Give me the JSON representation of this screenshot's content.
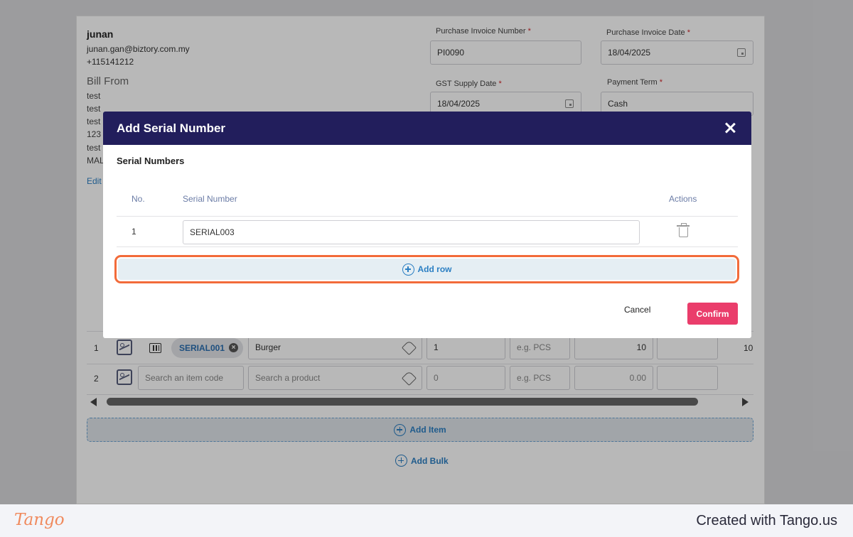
{
  "company": {
    "name": "junan",
    "email": "junan.gan@biztory.com.my",
    "phone": "+115141212",
    "bill_from_label": "Bill From",
    "address_lines": [
      "test",
      "test",
      "test",
      "123",
      "test",
      "MAL"
    ],
    "edit_label": "Edit"
  },
  "invoice_fields": {
    "purchase_invoice_number_label": "Purchase Invoice Number",
    "purchase_invoice_number_value": "PI0090",
    "purchase_invoice_date_label": "Purchase Invoice Date",
    "purchase_invoice_date_value": "18/04/2025",
    "gst_supply_date_label": "GST Supply Date",
    "gst_supply_date_value": "18/04/2025",
    "payment_term_label": "Payment Term",
    "payment_term_value": "Cash",
    "required_mark": "*"
  },
  "items": [
    {
      "no": "1",
      "serial_chip": "SERIAL001",
      "product": "Burger",
      "qty": "1",
      "uom_placeholder": "e.g. PCS",
      "price": "10",
      "overflow": "10"
    },
    {
      "no": "2",
      "item_code_placeholder": "Search an item code",
      "product_placeholder": "Search a product",
      "qty_placeholder": "0",
      "uom_placeholder": "e.g. PCS",
      "price_placeholder": "0.00"
    }
  ],
  "add_item_label": "Add Item",
  "add_bulk_label": "Add Bulk",
  "modal": {
    "title": "Add Serial Number",
    "section_title": "Serial Numbers",
    "columns": {
      "no": "No.",
      "serial": "Serial Number",
      "actions": "Actions"
    },
    "rows": [
      {
        "no": "1",
        "serial": "SERIAL003"
      }
    ],
    "add_row_label": "Add row",
    "cancel_label": "Cancel",
    "confirm_label": "Confirm"
  },
  "footer": {
    "logo_text": "Tango",
    "created_with": "Created with Tango.us"
  },
  "colors": {
    "modal_header": "#221e5c",
    "confirm_button": "#ea3d6b",
    "link_blue": "#2b7fc3",
    "highlight_orange": "#f26b3a"
  }
}
